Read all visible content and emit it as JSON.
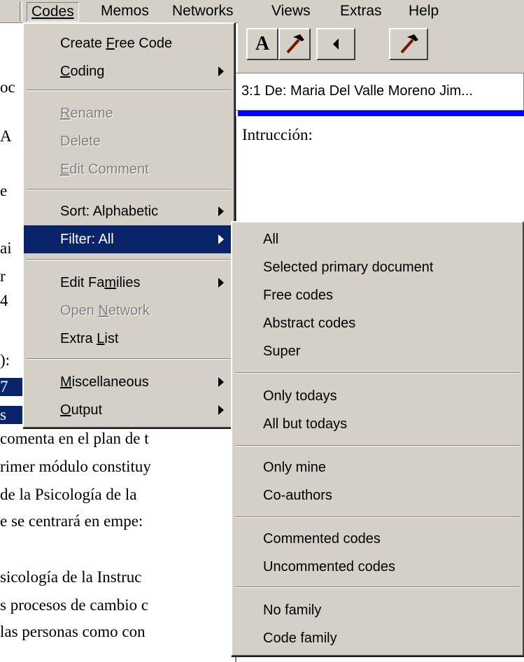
{
  "menubar": {
    "items": [
      {
        "label": "Codes"
      },
      {
        "label": "Memos"
      },
      {
        "label": "Networks"
      },
      {
        "label": "Views"
      },
      {
        "label": "Extras"
      },
      {
        "label": "Help"
      }
    ]
  },
  "toolbar": {
    "buttons": [
      {
        "icon": "letter-a-icon",
        "glyph": "A"
      },
      {
        "icon": "hammer-icon"
      },
      {
        "icon": "triangle-left-icon"
      },
      {
        "icon": "hammer-icon"
      }
    ]
  },
  "document": {
    "title_field": "3:1 De: Maria Del Valle Moreno Jim...",
    "body_heading": "Intrucción:",
    "left_fragments": [
      "oc",
      "A",
      "e",
      "ai",
      "r",
      "4",
      "):",
      "7",
      "s"
    ],
    "lines": [
      "comenta en el plan de t",
      "rimer módulo constituy",
      " de la Psicología de la",
      "e se centrará en empe:",
      "",
      "sicología de la Instruc",
      "s procesos de cambio c",
      "las personas como con"
    ]
  },
  "codes_menu": {
    "items": [
      {
        "pre": "Create ",
        "u": "F",
        "post": "ree Code"
      },
      {
        "pre": "",
        "u": "C",
        "post": "oding"
      },
      {
        "pre": "",
        "u": "R",
        "post": "ename"
      },
      {
        "pre": "Delete",
        "u": "",
        "post": ""
      },
      {
        "pre": "",
        "u": "E",
        "post": "dit Comment"
      },
      {
        "pre": "Sort: Alphabetic",
        "u": "",
        "post": ""
      },
      {
        "pre": "Filter: All",
        "u": "",
        "post": ""
      },
      {
        "pre": "Edit Fa",
        "u": "m",
        "post": "ilies"
      },
      {
        "pre": "Open ",
        "u": "N",
        "post": "etwork"
      },
      {
        "pre": "Extra ",
        "u": "L",
        "post": "ist"
      },
      {
        "pre": "",
        "u": "M",
        "post": "iscellaneous"
      },
      {
        "pre": "",
        "u": "O",
        "post": "utput"
      }
    ]
  },
  "filter_submenu": {
    "items": [
      "All",
      "Selected primary document",
      "Free codes",
      "Abstract codes",
      "Super",
      "Only todays",
      "All but todays",
      "Only mine",
      "Co-authors",
      "Commented codes",
      "Uncommented codes",
      "No family",
      "Code family"
    ]
  },
  "colors": {
    "menu_bg": "#d4d0c8",
    "highlight": "#0a246a",
    "desktop": "#0000ff"
  }
}
